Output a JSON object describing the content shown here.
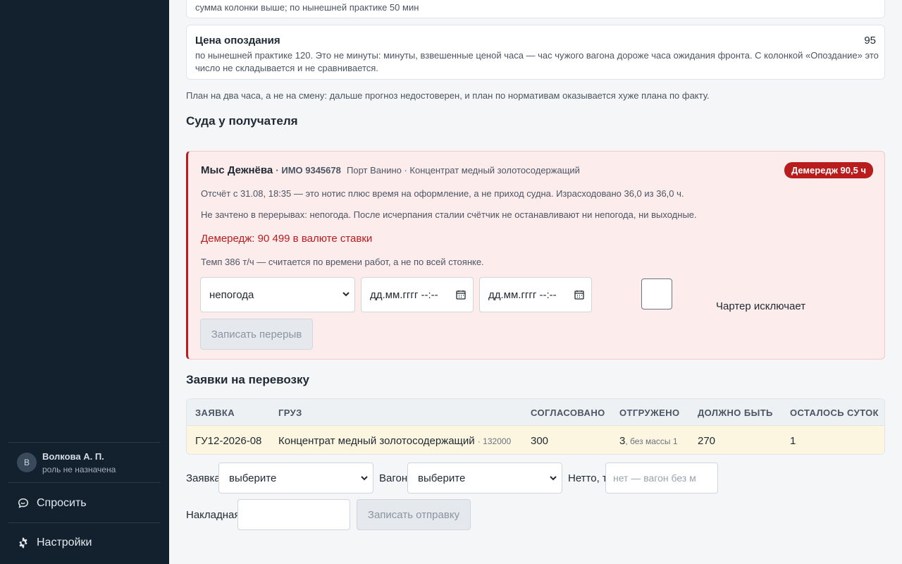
{
  "sidebar": {
    "user": {
      "initial": "В",
      "name": "Волкова А. П.",
      "role": "роль не назначена"
    },
    "nav": [
      {
        "label": "Спросить",
        "icon": "chat-icon"
      },
      {
        "label": "Настройки",
        "icon": "gear-icon"
      }
    ]
  },
  "top_card": {
    "text": "сумма колонки выше; по нынешней практике 50 мин"
  },
  "late_card": {
    "title": "Цена опоздания",
    "value": "95",
    "desc": "по нынешней практике 120. Это не минуты: минуты, взвешенные ценой часа — час чужого вагона дороже часа ожидания фронта. С колонкой «Опоздание» это число не складывается и не сравнивается."
  },
  "plan_note": "План на два часа, а не на смену: дальше прогноз недостоверен, и план по нормативам оказывается хуже плана по факту.",
  "vessels_section": {
    "title": "Суда у получателя"
  },
  "vessel": {
    "name": "Мыс Дежнёва",
    "imo": "· ИМО 9345678",
    "port_cargo": "Порт Ванино · Концентрат медный золотосодержащий",
    "badge": "Демередж 90,5 ч",
    "line1": "Отсчёт с 31.08, 18:35 — это нотис плюс время на оформление, а не приход судна. Израсходовано 36,0 из 36,0 ч.",
    "line2": "Не зачтено в перерывах: непогода. После исчерпания сталии счётчик не останавливают ни непогода, ни выходные.",
    "demurrage": "Демередж: 90 499 в валюте ставки",
    "rate": "Темп 386 т/ч — считается по времени работ, а не по всей стоянке.",
    "break_type": "непогода",
    "from_placeholder": "дд.мм.гггг --:--",
    "to_placeholder": "дд.мм.гггг --:--",
    "charter_label": "Чартер исключает",
    "record_break": "Записать перерыв"
  },
  "orders_section": {
    "title": "Заявки на перевозку"
  },
  "orders_table": {
    "headers": [
      "ЗАЯВКА",
      "ГРУЗ",
      "СОГЛАСОВАНО",
      "ОТГРУЖЕНО",
      "ДОЛЖНО БЫТЬ",
      "ОСТАЛОСЬ СУТОК"
    ],
    "row": {
      "order": "ГУ12-2026-08",
      "cargo": "Концентрат медный золотосодержащий",
      "cargo_code": "· 132000",
      "agreed": "300",
      "shipped": "3",
      "shipped_note": ", без массы 1",
      "should_be": "270",
      "days_left": "1"
    }
  },
  "shipment_form": {
    "order_label": "Заявка",
    "order_value": "выберите",
    "wagon_label": "Вагон",
    "wagon_value": "выберите",
    "net_label": "Нетто, т",
    "net_placeholder": "нет — вагон без м",
    "waybill_label": "Накладная",
    "submit": "Записать отправку"
  }
}
